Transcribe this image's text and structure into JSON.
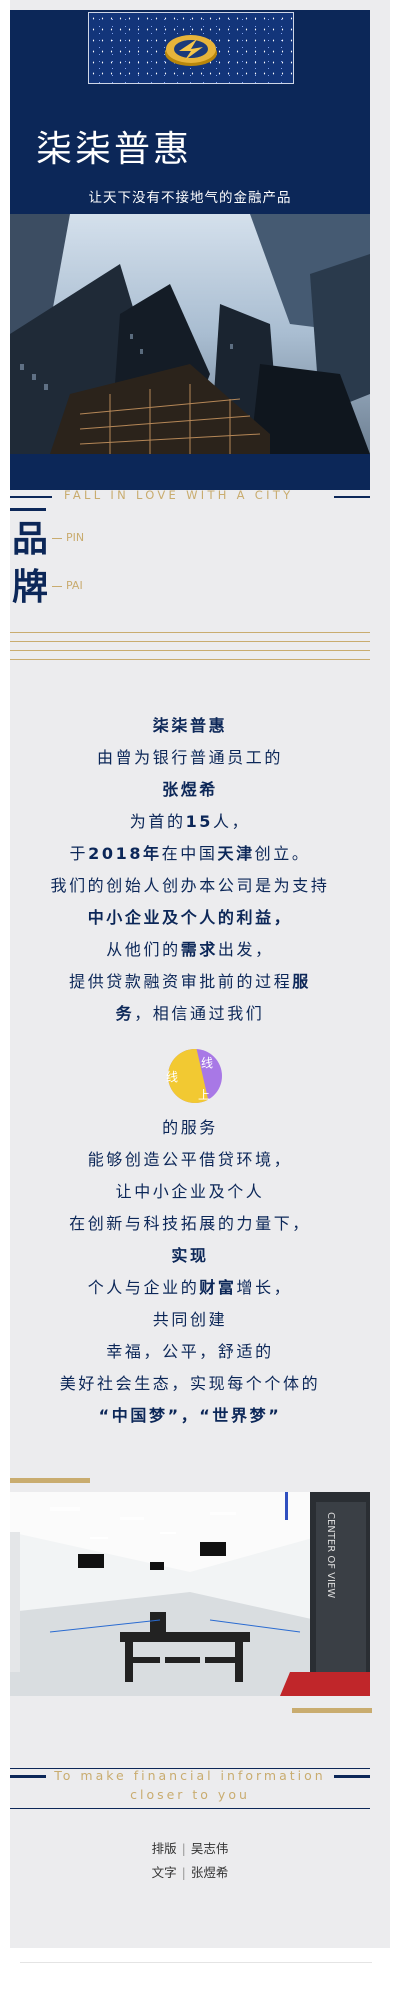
{
  "hero": {
    "title": "柒柒普惠",
    "tagline": "让天下没有不接地气的金融产品"
  },
  "banner": {
    "fall_text": "FALL IN LOVE WITH A CITY",
    "brand_chars": [
      "品",
      "牌"
    ],
    "pin_label": "PIN",
    "pai_label": "PAI"
  },
  "story": {
    "company": "柒柒普惠",
    "l2": "由曾为银行普通员工的",
    "founder": "张煜希",
    "l4_a": "为首的",
    "l4_b": "15",
    "l4_c": "人，",
    "l5_a": "于",
    "l5_b": "2018年",
    "l5_c": "在中国",
    "l5_d": "天津",
    "l5_e": "创立。",
    "l6": "我们的创始人创办本公司是为支持",
    "l7": "中小企业及个人的利益，",
    "l8_a": "从他们的",
    "l8_b": "需求",
    "l8_c": "出发，",
    "l9_a": "提供贷款融资审批前的过程",
    "l9_b": "服",
    "l10_a": "务",
    "l10_b": "，相信通过我们",
    "circle_top": "线",
    "circle_left": "线",
    "circle_bottom": "上",
    "l11": "的服务",
    "l12": "能够创造公平借贷环境，",
    "l13": "让中小企业及个人",
    "l14": "在创新与科技拓展的力量下，",
    "l15": "实现",
    "l16_a": "个人与企业的",
    "l16_b": "财富",
    "l16_c": "增长，",
    "l17": "共同创建",
    "l18": "幸福，公平，舒适的",
    "l19": "美好社会生态，实现每个个体的",
    "l20": "“中国梦”，“世界梦”"
  },
  "office": {
    "sign_text": "CENTER OF VIEW"
  },
  "footer": {
    "line1": "To make financial information",
    "line2": "closer to you",
    "credit1_label": "排版",
    "credit1_name": "吴志伟",
    "credit2_label": "文字",
    "credit2_name": "张煜希"
  },
  "colors": {
    "navy": "#0c2758",
    "gold": "#c9ac6f",
    "panel": "#ececee",
    "circle_yellow": "#f2c932",
    "circle_purple": "#a878e6"
  }
}
